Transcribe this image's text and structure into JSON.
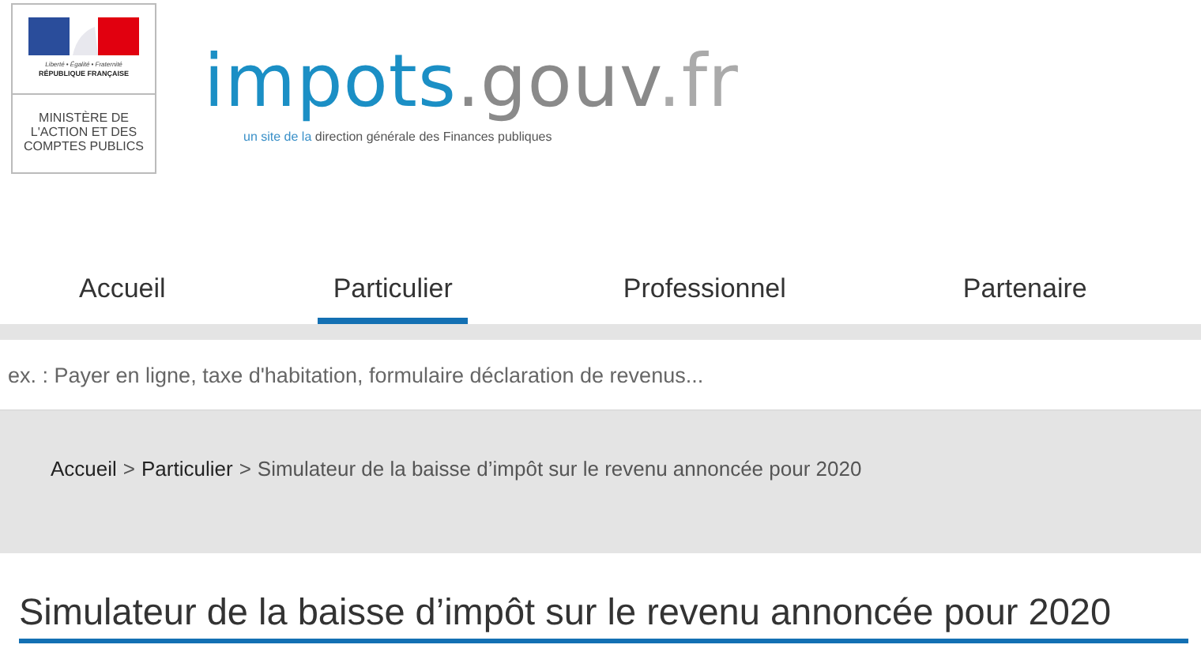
{
  "header": {
    "marianne": {
      "motto": "Liberté • Égalité • Fraternité",
      "republic": "RÉPUBLIQUE FRANÇAISE",
      "ministry": [
        "MINISTÈRE DE",
        "L'ACTION ET DES",
        "COMPTES PUBLICS"
      ]
    },
    "logo": {
      "part_1": "impots",
      "part_2": ".gouv",
      "part_3": ".fr"
    },
    "tagline": {
      "part_1": "un site de la",
      "part_2": "direction générale des Finances publiques"
    }
  },
  "tabs": [
    {
      "label": "Accueil",
      "selected": false
    },
    {
      "label": "Particulier",
      "selected": true
    },
    {
      "label": "Professionnel",
      "selected": false
    },
    {
      "label": "Partenaire",
      "selected": false
    }
  ],
  "search": {
    "placeholder": "ex. : Payer en ligne, taxe d'habitation, formulaire déclaration de revenus..."
  },
  "breadcrumb": [
    {
      "kind": "link",
      "label": "Accueil"
    },
    {
      "kind": "separator",
      "label": ">"
    },
    {
      "kind": "link",
      "label": "Particulier"
    },
    {
      "kind": "separator",
      "label": ">"
    },
    {
      "kind": "current",
      "label": "Simulateur de la baisse d’impôt sur le revenu annoncée pour 2020"
    }
  ],
  "page_title": "Simulateur de la baisse d’impôt sur le revenu annoncée pour 2020"
}
